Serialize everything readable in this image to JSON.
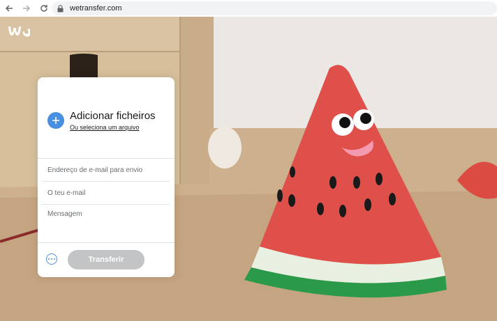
{
  "browser": {
    "url": "wetransfer.com",
    "icons": [
      "back-icon",
      "forward-icon",
      "reload-icon",
      "lock-icon"
    ]
  },
  "brand": {
    "logo_icon": "wetransfer-logo"
  },
  "upload_panel": {
    "add_title": "Adicionar ficheiros",
    "add_subtitle": "Ou seleciona um arquivo",
    "recipient_placeholder": "Endereço de e-mail para envio",
    "sender_placeholder": "O teu e-mail",
    "message_placeholder": "Mensagem",
    "transfer_label": "Transferir",
    "more_options_icon": "more-options-icon",
    "add_icon": "plus-icon"
  },
  "colors": {
    "accent_blue": "#4a90e2",
    "button_disabled": "#c2c4c6",
    "watermelon_red": "#e0504a",
    "rind_green": "#2a9a4a"
  }
}
